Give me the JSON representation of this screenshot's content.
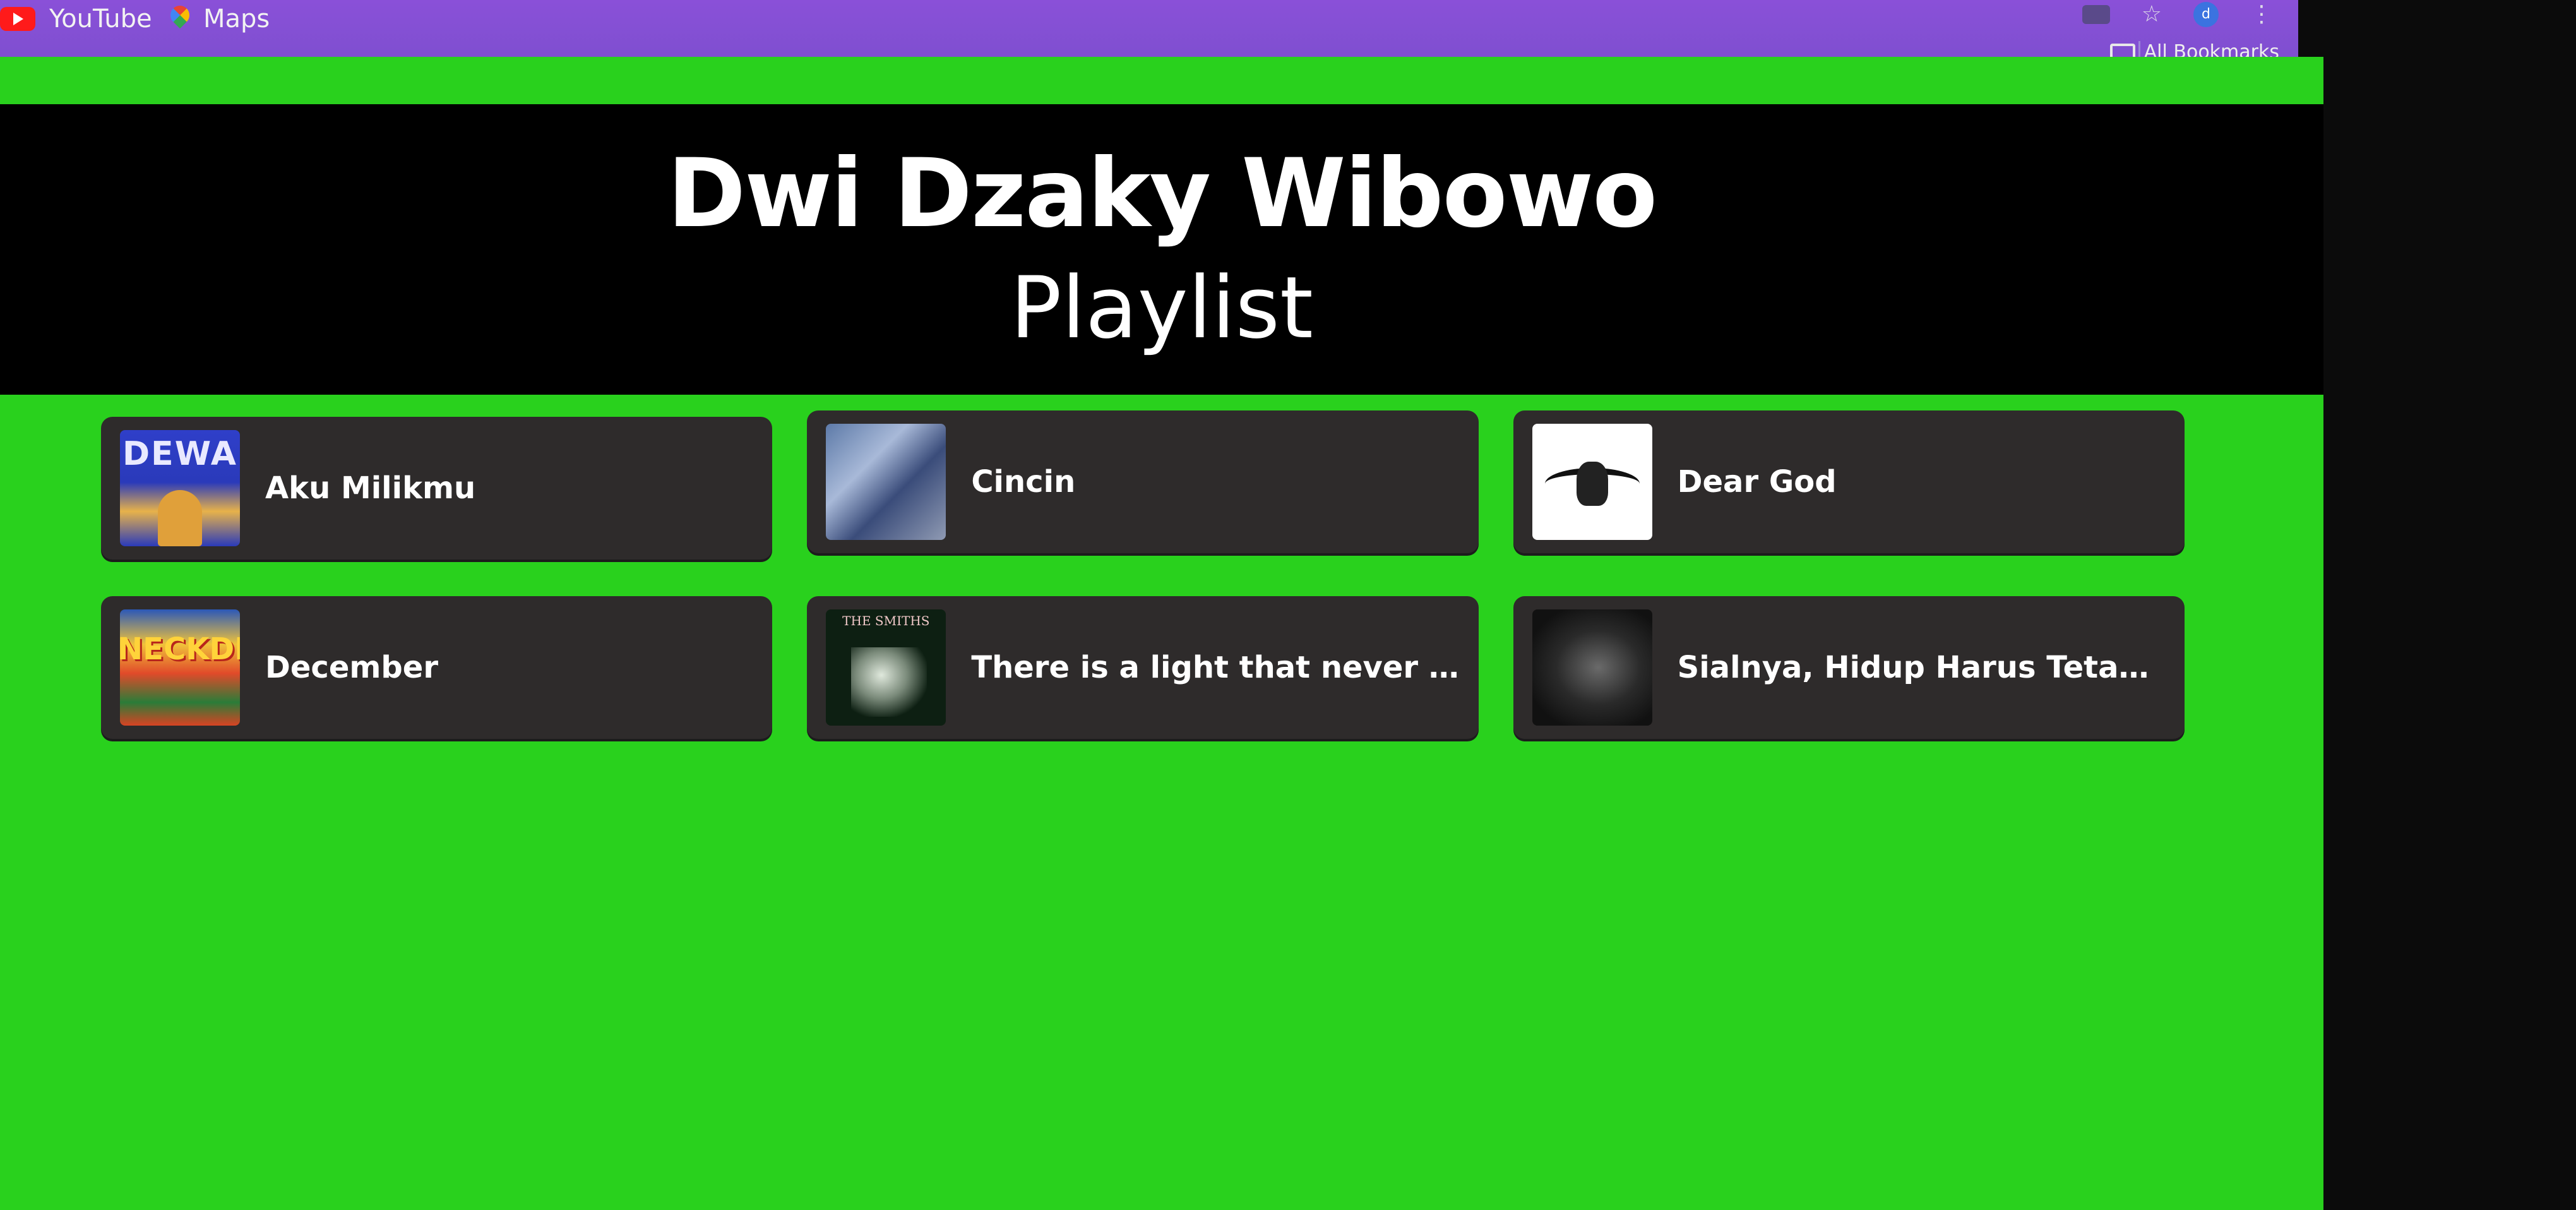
{
  "browser": {
    "bookmarks": [
      {
        "label": "YouTube",
        "icon": "youtube-icon"
      },
      {
        "label": "Maps",
        "icon": "maps-icon"
      }
    ],
    "all_bookmarks_label": "All Bookmarks",
    "profile_initial": "d"
  },
  "page": {
    "title": "Dwi Dzaky Wibowo",
    "subtitle": "Playlist",
    "background_color": "#29d11d",
    "header_color": "#000000",
    "card_color": "#2e2b2b"
  },
  "playlist": [
    {
      "title": "Aku Milikmu",
      "cover_text": "DEWA"
    },
    {
      "title": "Cincin"
    },
    {
      "title": "Dear God"
    },
    {
      "title": "December",
      "cover_text": "NECKDEEP"
    },
    {
      "title": "There is a light that never goes out",
      "cover_text": "THE SMITHS"
    },
    {
      "title": "Sialnya, Hidup Harus Tetap Berjalan"
    }
  ]
}
